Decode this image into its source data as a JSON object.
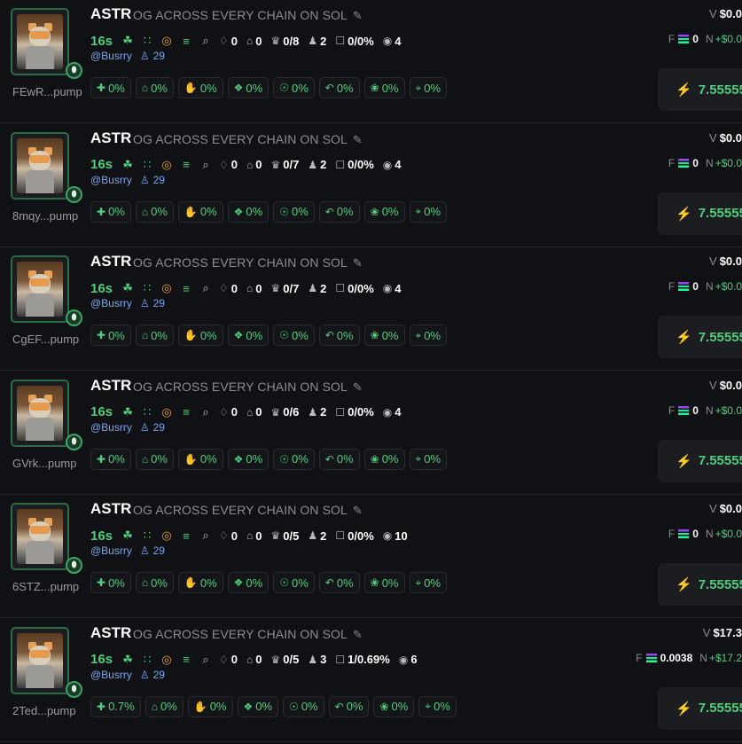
{
  "rows": [
    {
      "name": "ASTR",
      "desc": "OG ACROSS EVERY CHAIN ON SOL",
      "age": "16s",
      "stats": [
        "0",
        "0",
        "0/8",
        "2",
        "0/0%",
        "4"
      ],
      "handle": "@Busrry",
      "followers": "29",
      "addr": "FEwR...pump",
      "chips": [
        "0%",
        "0%",
        "0%",
        "0%",
        "0%",
        "0%",
        "0%",
        "0%"
      ],
      "v": "$0.0",
      "f": "0",
      "n": "+$0.0",
      "buy": "7.55555"
    },
    {
      "name": "ASTR",
      "desc": "OG ACROSS EVERY CHAIN ON SOL",
      "age": "16s",
      "stats": [
        "0",
        "0",
        "0/7",
        "2",
        "0/0%",
        "4"
      ],
      "handle": "@Busrry",
      "followers": "29",
      "addr": "8mqy...pump",
      "chips": [
        "0%",
        "0%",
        "0%",
        "0%",
        "0%",
        "0%",
        "0%",
        "0%"
      ],
      "v": "$0.0",
      "f": "0",
      "n": "+$0.0",
      "buy": "7.55555"
    },
    {
      "name": "ASTR",
      "desc": "OG ACROSS EVERY CHAIN ON SOL",
      "age": "16s",
      "stats": [
        "0",
        "0",
        "0/7",
        "2",
        "0/0%",
        "4"
      ],
      "handle": "@Busrry",
      "followers": "29",
      "addr": "CgEF...pump",
      "chips": [
        "0%",
        "0%",
        "0%",
        "0%",
        "0%",
        "0%",
        "0%",
        "0%"
      ],
      "v": "$0.0",
      "f": "0",
      "n": "+$0.0",
      "buy": "7.55555"
    },
    {
      "name": "ASTR",
      "desc": "OG ACROSS EVERY CHAIN ON SOL",
      "age": "16s",
      "stats": [
        "0",
        "0",
        "0/6",
        "2",
        "0/0%",
        "4"
      ],
      "handle": "@Busrry",
      "followers": "29",
      "addr": "GVrk...pump",
      "chips": [
        "0%",
        "0%",
        "0%",
        "0%",
        "0%",
        "0%",
        "0%",
        "0%"
      ],
      "v": "$0.0",
      "f": "0",
      "n": "+$0.0",
      "buy": "7.55555"
    },
    {
      "name": "ASTR",
      "desc": "OG ACROSS EVERY CHAIN ON SOL",
      "age": "16s",
      "stats": [
        "0",
        "0",
        "0/5",
        "2",
        "0/0%",
        "10"
      ],
      "handle": "@Busrry",
      "followers": "29",
      "addr": "6STZ...pump",
      "chips": [
        "0%",
        "0%",
        "0%",
        "0%",
        "0%",
        "0%",
        "0%",
        "0%"
      ],
      "v": "$0.0",
      "f": "0",
      "n": "+$0.0",
      "buy": "7.55555"
    },
    {
      "name": "ASTR",
      "desc": "OG ACROSS EVERY CHAIN ON SOL",
      "age": "16s",
      "stats": [
        "0",
        "0",
        "0/5",
        "3",
        "1/0.69%",
        "6"
      ],
      "handle": "@Busrry",
      "followers": "29",
      "addr": "2Ted...pump",
      "chips": [
        "0.7%",
        "0%",
        "0%",
        "0%",
        "0%",
        "0%",
        "0%",
        "0%"
      ],
      "v": "$17.3",
      "f": "0.0038",
      "n": "+$17.2",
      "buy": "7.55555"
    }
  ],
  "labels": {
    "v": "V",
    "f": "F",
    "n": "N"
  },
  "icons": {
    "line2": [
      "leaf-icon",
      "people-icon",
      "coin-icon",
      "chart-icon",
      "search-icon"
    ],
    "stats": [
      "trophy-icon",
      "chef-icon",
      "crown-icon",
      "holders-icon",
      "bot-icon",
      "eye-icon"
    ],
    "chips": [
      "user-plus-icon",
      "chef-hat-icon",
      "hand-icon",
      "layers-icon",
      "sniper-icon",
      "hook-icon",
      "sprout-icon",
      "target-icon"
    ]
  },
  "colors": {
    "accent": "#4fcf7e",
    "link": "#7aa6f0",
    "gold": "#e6a23c",
    "bg": "#101114"
  }
}
